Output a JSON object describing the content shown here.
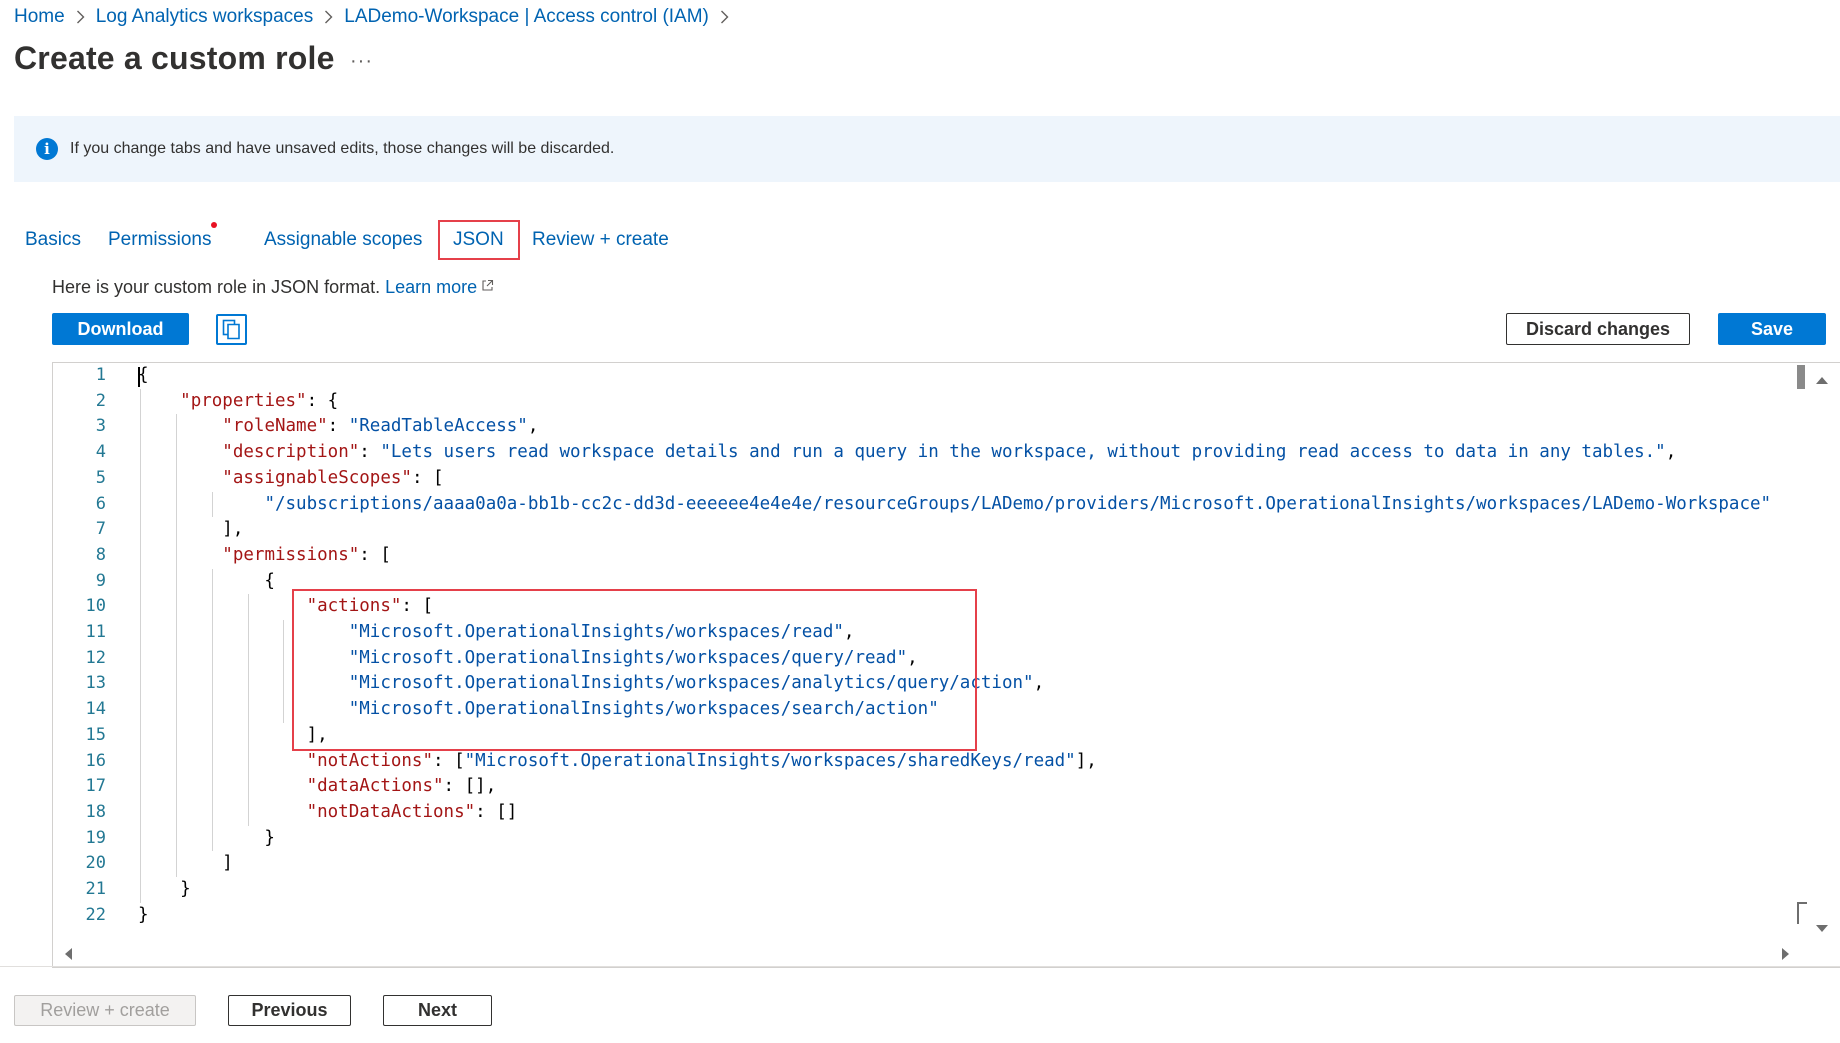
{
  "breadcrumb": [
    {
      "label": "Home"
    },
    {
      "label": "Log Analytics workspaces"
    },
    {
      "label": "LADemo-Workspace | Access control (IAM)"
    }
  ],
  "page": {
    "title": "Create a custom role",
    "more_label": "···"
  },
  "info_banner": {
    "icon": "info-icon",
    "text": "If you change tabs and have unsaved edits, those changes will be discarded."
  },
  "tabs": [
    {
      "label": "Basics",
      "active": false
    },
    {
      "label": "Permissions",
      "active": false,
      "has_unsaved_indicator": true
    },
    {
      "label": "Assignable scopes",
      "active": false
    },
    {
      "label": "JSON",
      "active": true
    },
    {
      "label": "Review + create",
      "active": false
    }
  ],
  "description": {
    "text": "Here is your custom role in JSON format.",
    "link_label": "Learn more"
  },
  "toolbar": {
    "download_label": "Download",
    "copy_icon": "copy-icon",
    "discard_label": "Discard changes",
    "save_label": "Save"
  },
  "editor": {
    "lines": [
      {
        "n": "1",
        "text": "{"
      },
      {
        "n": "2",
        "text": "    \"properties\": {"
      },
      {
        "n": "3",
        "text": "        \"roleName\": \"ReadTableAccess\","
      },
      {
        "n": "4",
        "text": "        \"description\": \"Lets users read workspace details and run a query in the workspace, without providing read access to data in any tables.\","
      },
      {
        "n": "5",
        "text": "        \"assignableScopes\": ["
      },
      {
        "n": "6",
        "text": "            \"/subscriptions/aaaa0a0a-bb1b-cc2c-dd3d-eeeeee4e4e4e/resourceGroups/LADemo/providers/Microsoft.OperationalInsights/workspaces/LADemo-Workspace\""
      },
      {
        "n": "7",
        "text": "        ],"
      },
      {
        "n": "8",
        "text": "        \"permissions\": ["
      },
      {
        "n": "9",
        "text": "            {"
      },
      {
        "n": "10",
        "text": "                \"actions\": ["
      },
      {
        "n": "11",
        "text": "                    \"Microsoft.OperationalInsights/workspaces/read\","
      },
      {
        "n": "12",
        "text": "                    \"Microsoft.OperationalInsights/workspaces/query/read\","
      },
      {
        "n": "13",
        "text": "                    \"Microsoft.OperationalInsights/workspaces/analytics/query/action\","
      },
      {
        "n": "14",
        "text": "                    \"Microsoft.OperationalInsights/workspaces/search/action\""
      },
      {
        "n": "15",
        "text": "                ],"
      },
      {
        "n": "16",
        "text": "                \"notActions\": [\"Microsoft.OperationalInsights/workspaces/sharedKeys/read\"],"
      },
      {
        "n": "17",
        "text": "                \"dataActions\": [],"
      },
      {
        "n": "18",
        "text": "                \"notDataActions\": []"
      },
      {
        "n": "19",
        "text": "            }"
      },
      {
        "n": "20",
        "text": "        ]"
      },
      {
        "n": "21",
        "text": "    }"
      },
      {
        "n": "22",
        "text": "}"
      }
    ]
  },
  "footer": {
    "review_create_label": "Review + create",
    "previous_label": "Previous",
    "next_label": "Next"
  },
  "colors": {
    "accent": "#0078d4",
    "link": "#0063b1",
    "highlight_box": "#e5404a",
    "json_key": "#a31515",
    "json_string": "#0451a5",
    "line_number": "#237893",
    "banner_bg": "#eef5fc"
  }
}
